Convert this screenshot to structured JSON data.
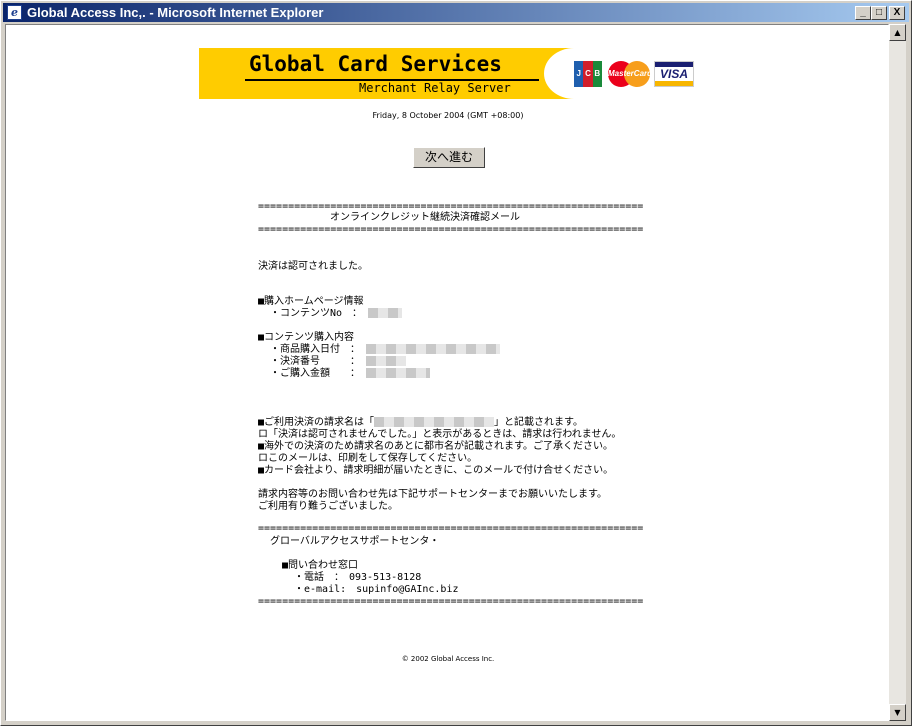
{
  "window": {
    "title": "Global Access Inc,. - Microsoft Internet Explorer",
    "minimize_glyph": "_",
    "maximize_glyph": "□",
    "close_glyph": "X"
  },
  "scrollbar": {
    "up_glyph": "▲",
    "down_glyph": "▼"
  },
  "banner": {
    "name": "Global Card Services",
    "subtitle": "Merchant Relay Server",
    "jcb": [
      "J",
      "C",
      "B"
    ],
    "mastercard": "MasterCard",
    "visa": "VISA",
    "colors": {
      "yellow": "#ffcc00",
      "jcb_blue": "#1f5fae",
      "jcb_red": "#d11e2b",
      "jcb_green": "#1a8a3a"
    }
  },
  "date": "Friday, 8 October 2004 (GMT +08:00)",
  "next_button": "次へ進む",
  "mail": {
    "separator": "================================================================",
    "heading": "オンラインクレジット継続決済確認メール",
    "approved": "決済は認可されました。",
    "section1_title": "■購入ホームページ情報",
    "content_no_label": "・コンテンツNo　：",
    "section2_title": "■コンテンツ購入内容",
    "purchase_date_label": "・商品購入日付　：",
    "payment_no_label": "・決済番号　　　：",
    "amount_label": "・ご購入金額　　：",
    "note1_a": "■ご利用決済の請求名は「",
    "note1_b": "」と記載されます。",
    "note2": "ロ「決済は認可されませんでした。」と表示があるときは、請求は行われません。",
    "note3": "■海外での決済のため請求名のあとに都市名が記載されます。ご了承ください。",
    "note4": "ロこのメールは、印刷をして保存してください。",
    "note5": "■カード会社より、請求明細が届いたときに、このメールで付け合せください。",
    "inquiry1": "請求内容等のお問い合わせ先は下記サポートセンターまでお願いいたします。",
    "inquiry2": "ご利用有り難うございました。",
    "support_title": "グローバルアクセスサポートセンタ・",
    "contact_title": "■問い合わせ窓口",
    "phone": "・電話　：　093-513-8128",
    "email": "・e-mail:　supinfo@GAInc.biz"
  },
  "copyright": "© 2002 Global Access Inc."
}
